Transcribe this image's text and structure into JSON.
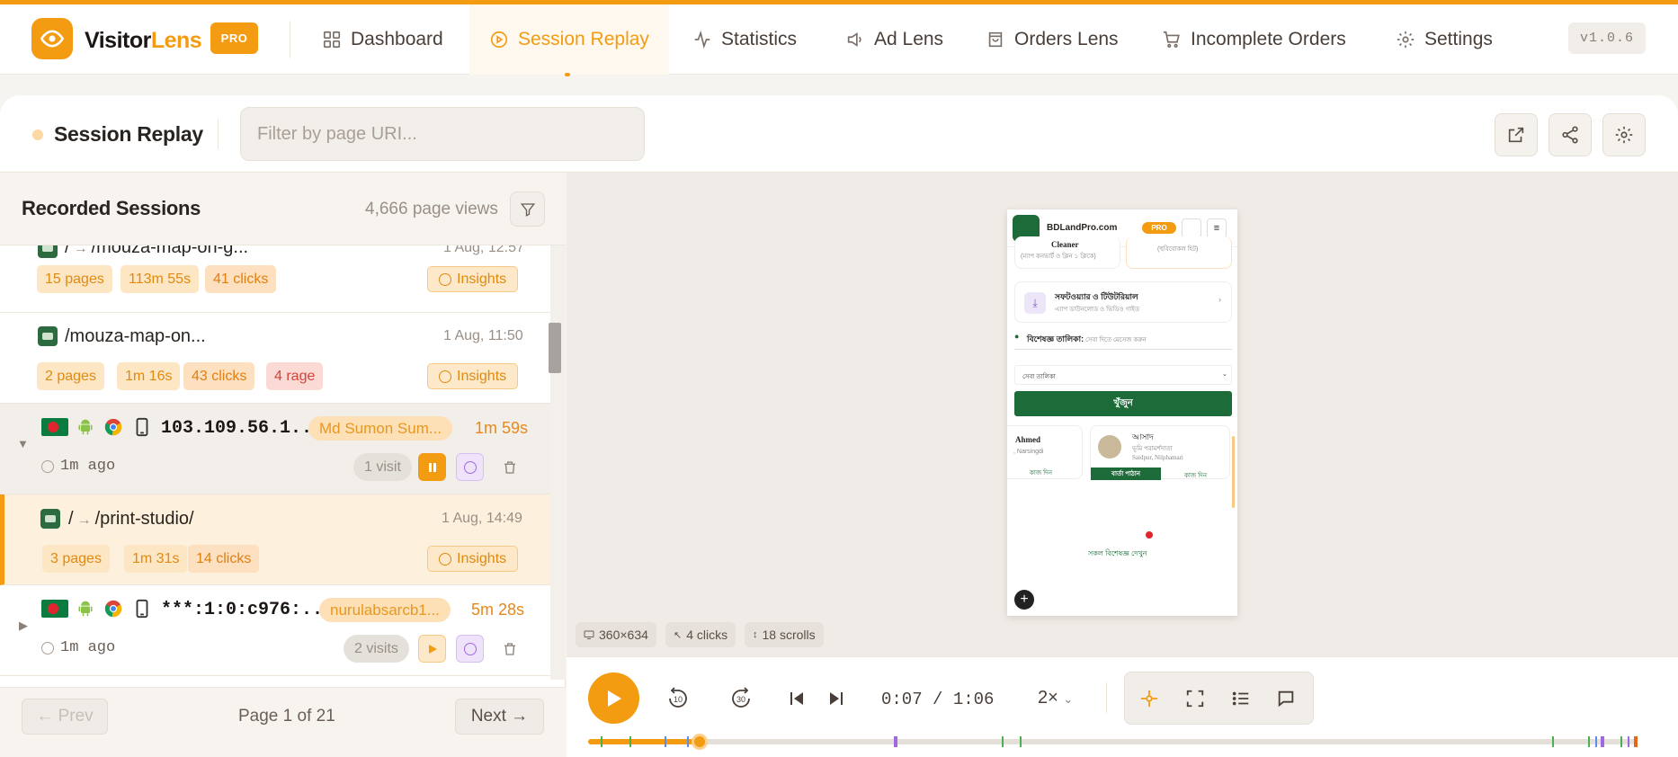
{
  "app": {
    "brand_part1": "Visitor",
    "brand_part2": "Lens",
    "pro_badge": "PRO",
    "version": "v1.0.6"
  },
  "nav": [
    {
      "label": "Dashboard",
      "icon": "grid-icon"
    },
    {
      "label": "Session Replay",
      "icon": "play-circle-icon",
      "active": true
    },
    {
      "label": "Statistics",
      "icon": "activity-icon"
    },
    {
      "label": "Ad Lens",
      "icon": "megaphone-icon"
    },
    {
      "label": "Orders Lens",
      "icon": "shopping-bag-icon"
    },
    {
      "label": "Incomplete Orders",
      "icon": "cart-icon"
    },
    {
      "label": "Settings",
      "icon": "gear-icon"
    }
  ],
  "toolbar": {
    "title": "Session Replay",
    "filter_placeholder": "Filter by page URI..."
  },
  "sessions_panel": {
    "title": "Recorded Sessions",
    "page_views": "4,666 page views"
  },
  "rows": {
    "r1": {
      "path": "/",
      "arrow": "→",
      "path2": "/mouza-map-on-g...",
      "time": "1 Aug, 12:57",
      "pages": "15 pages",
      "duration": "113m 55s",
      "clicks": "41 clicks",
      "insights": "Insights"
    },
    "r2": {
      "path": "/mouza-map-on...",
      "time": "1 Aug, 11:50",
      "pages": "2 pages",
      "duration": "1m 16s",
      "clicks": "43 clicks",
      "rage": "4 rage",
      "insights": "Insights"
    },
    "s1": {
      "ip": "103.109.56.1...",
      "user": "Md Sumon Sum...",
      "duration": "1m 59s",
      "ago": "1m ago",
      "visits": "1 visit"
    },
    "r3": {
      "path": "/",
      "arrow": "→",
      "path2": "/print-studio/",
      "time": "1 Aug, 14:49",
      "pages": "3 pages",
      "duration": "1m 31s",
      "clicks": "14 clicks",
      "insights": "Insights"
    },
    "s2": {
      "ip": "***:1:0:c976:...",
      "user": "nurulabsarcb1...",
      "duration": "5m 28s",
      "ago": "1m ago",
      "visits": "2 visits"
    }
  },
  "pager": {
    "prev": "← Prev",
    "next": "Next →",
    "info": "Page 1 of 21"
  },
  "preview": {
    "site": "BDLandPro.com",
    "pro": "PRO",
    "cleaner": "Cleaner",
    "cleaner_sub": "(ম্যাপ কনভার্ট ও ক্লিন ১ ক্লিকে)",
    "card2_sub": "(হুবিবোকল হিট)",
    "software_title": "সফটওয়্যার ও টিউটরিয়াল",
    "software_sub": "এ্যাপ ডাউনলোড ও ভিডিও গাইড",
    "expert_title": "বিশেষজ্ঞ তালিকা:",
    "expert_sub": "সেবা দিতে মেসেজ করুন",
    "select": "সেবা তালিকা",
    "search_btn": "খুঁজুন",
    "card_a_name": "Ahmed",
    "card_a_loc": ", Narsingdi",
    "card_a_btn": "কাজ দিন",
    "card_b_name": "আসাদ",
    "card_b_role": "ভূমি পরামর্শদাতা",
    "card_b_loc": "Saidpur, Nilphamari",
    "card_b_btn1": "বার্তা পাঠান",
    "card_b_btn2": "কাজ দিন",
    "all_experts": "সকল বিশেষজ্ঞ দেখুন"
  },
  "stats": {
    "viewport": "360×634",
    "clicks": "4 clicks",
    "scrolls": "18 scrolls"
  },
  "player": {
    "time": "0:07 / 1:06",
    "speed": "2×",
    "rewind": "10",
    "forward": "30",
    "progress": 0.106,
    "accent": "#f39c12"
  }
}
